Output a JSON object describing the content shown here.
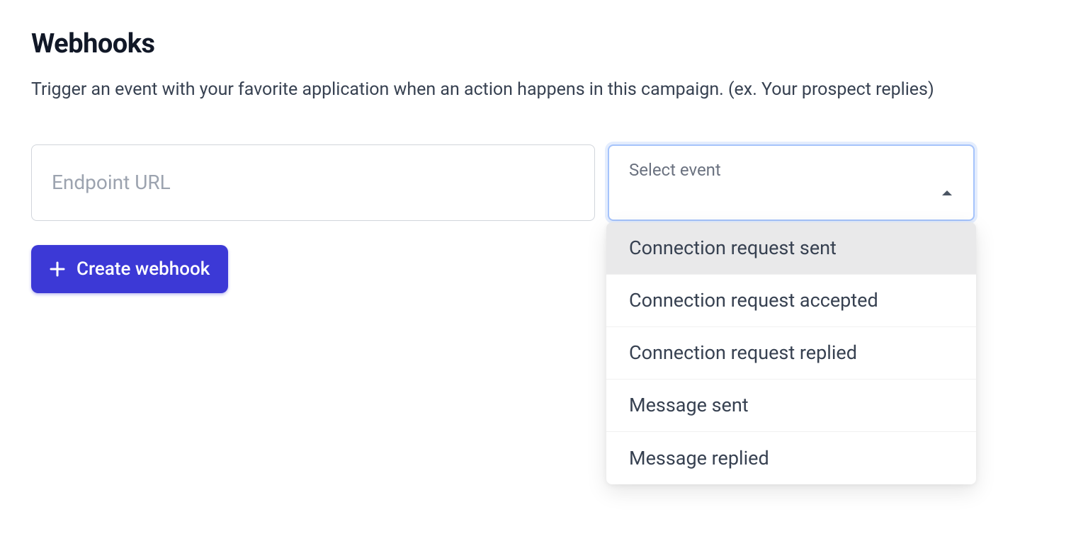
{
  "header": {
    "title": "Webhooks",
    "subtitle": "Trigger an event with your favorite application when an action happens in this campaign. (ex. Your prospect replies)"
  },
  "form": {
    "endpoint_placeholder": "Endpoint URL",
    "endpoint_value": "",
    "select_label": "Select event",
    "options": [
      "Connection request sent",
      "Connection request accepted",
      "Connection request replied",
      "Message sent",
      "Message replied"
    ],
    "highlighted_index": 0
  },
  "button": {
    "create_label": "Create webhook"
  }
}
